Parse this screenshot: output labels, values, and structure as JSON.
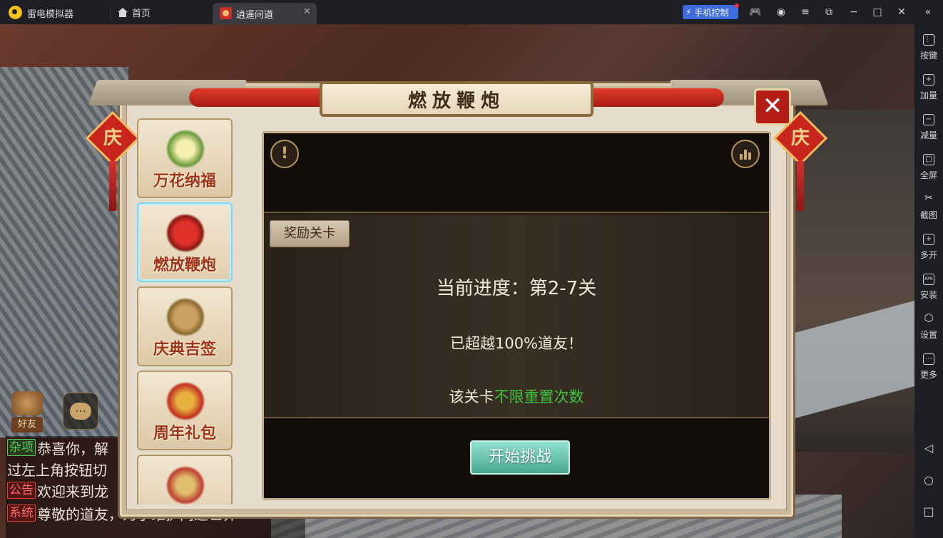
{
  "titlebar": {
    "app_name": "雷电模拟器",
    "home_tab": "首页",
    "game_tab": "逍遥问道",
    "close_glyph": "✕",
    "phone_control": "手机控制",
    "icons": [
      "gamepad-icon",
      "user-icon",
      "menu-icon",
      "popout-icon",
      "minimize-icon",
      "maximize-icon",
      "close-icon",
      "collapse-icon"
    ]
  },
  "dialog": {
    "title": "燃放鞭炮",
    "close_glyph": "✕",
    "ornament_char": "庆",
    "tabs": [
      {
        "label": "万花纳福",
        "active": false
      },
      {
        "label": "燃放鞭炮",
        "active": true
      },
      {
        "label": "庆典吉签",
        "active": false
      },
      {
        "label": "周年礼包",
        "active": false
      },
      {
        "label": "",
        "active": false
      }
    ],
    "panel": {
      "info_glyph": "!",
      "reward_button": "奖励关卡",
      "progress": "当前进度：第2-7关",
      "surpass": "已超越100%道友！",
      "reset_prefix": "该关卡",
      "reset_highlight": "不限重置次数",
      "start_button": "开始挑战"
    }
  },
  "hud": {
    "friend_label": "好友",
    "chat_glyph": "…",
    "chat": [
      {
        "tag": "杂项",
        "text": "恭喜你，解"
      },
      {
        "tag": "",
        "text": "过左上角按钮切"
      },
      {
        "tag": "公告",
        "text": "欢迎来到龙"
      },
      {
        "tag": "系统",
        "text": "尊敬的道友，为了维护问道世界"
      }
    ]
  },
  "sidebar": {
    "items": [
      {
        "label": "按键",
        "glyph": "⋮⋮"
      },
      {
        "label": "加量",
        "glyph": "+"
      },
      {
        "label": "减量",
        "glyph": "−"
      },
      {
        "label": "全屏",
        "glyph": "□"
      },
      {
        "label": "截图",
        "glyph": "✂"
      },
      {
        "label": "多开",
        "glyph": "+"
      },
      {
        "label": "安装",
        "glyph": "APK"
      },
      {
        "label": "设置",
        "glyph": "⬡"
      },
      {
        "label": "更多",
        "glyph": "⋯"
      }
    ],
    "nav": [
      {
        "name": "back",
        "glyph": "◁"
      },
      {
        "name": "home",
        "glyph": "○"
      },
      {
        "name": "recents",
        "glyph": "□"
      }
    ]
  },
  "colors": {
    "accent_blue": "#3e6ae0",
    "title_red": "#b51d17",
    "highlight_green": "#3ec53e",
    "start_button": "#4aa893"
  }
}
